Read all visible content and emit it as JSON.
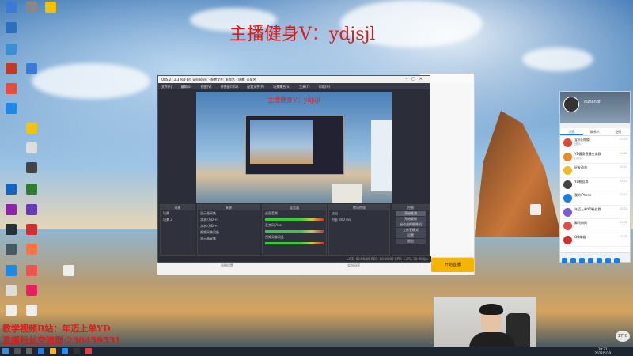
{
  "overlay": {
    "title": "主播健身V：ydjsjl",
    "bottom_line1": "教学视频B站：年迈上单YD",
    "bottom_line2": "直播粉丝交流群:230459531"
  },
  "obs": {
    "window_title": "OBS 27.2.3 (64-bit, windows) - 配置文件: 未命名 - 场景: 未命名",
    "menu": [
      "文件(F)",
      "编辑(E)",
      "视图(V)",
      "停靠窗口(D)",
      "配置文件(P)",
      "场景集合(S)",
      "工具(T)",
      "帮助(H)"
    ],
    "preview_title": "主播健身V：ydjsjl",
    "docks": {
      "scenes": {
        "title": "场景",
        "items": [
          "场景",
          "场景 2"
        ]
      },
      "sources": {
        "title": "来源",
        "items": [
          "显示器采集",
          "文本 (GDI+)",
          "文本 (GDI+)",
          "视频采集设备",
          "显示器采集"
        ]
      },
      "mixer": {
        "title": "混音器",
        "items": [
          "桌面音频",
          "麦克风/Aux",
          "视频采集设备"
        ]
      },
      "transitions": {
        "title": "转场特效",
        "items": [
          "淡出",
          "时长 300 ms"
        ]
      },
      "controls": {
        "title": "控制",
        "buttons": [
          "开始推流",
          "开始录制",
          "启动虚拟摄像机",
          "工作室模式",
          "设置",
          "退出"
        ]
      }
    },
    "status": "LIVE: 00:00:00  REC: 00:00:00  CPU: 1.2%, 30.00 fps"
  },
  "back_window": {
    "start_label": "开始直播",
    "settings_label": "直播设置",
    "bitrate_label": "实时码率"
  },
  "qq": {
    "nickname": "dunandh",
    "tabs": [
      "消息",
      "联系人",
      "空间"
    ],
    "conversations": [
      {
        "name": "宝卡旧物群",
        "msg": "[图片]",
        "time": "17:30",
        "color": "#d94a3a"
      },
      {
        "name": "YD健身直播交流群",
        "msg": "[文件]",
        "time": "20:22",
        "color": "#e88a2a"
      },
      {
        "name": "好友动态",
        "msg": "",
        "time": "13:07",
        "color": "#f2b829"
      },
      {
        "name": "YD粉丝群",
        "msg": "",
        "time": "13:07",
        "color": "#444444"
      },
      {
        "name": "我的iPhone",
        "msg": "",
        "time": "12:43",
        "color": "#1a7ce0"
      },
      {
        "name": "年迈上单YD粉丝群",
        "msg": "",
        "time": "12:43",
        "color": "#7a5ad0"
      },
      {
        "name": "腾讯新闻",
        "msg": "",
        "time": "11:02",
        "color": "#e04a4a"
      },
      {
        "name": "QQ邮箱",
        "msg": "",
        "time": "10:58",
        "color": "#d03030"
      }
    ]
  },
  "taskbar": {
    "time": "20:21",
    "date": "2022/5/20",
    "weather": "17°C"
  }
}
